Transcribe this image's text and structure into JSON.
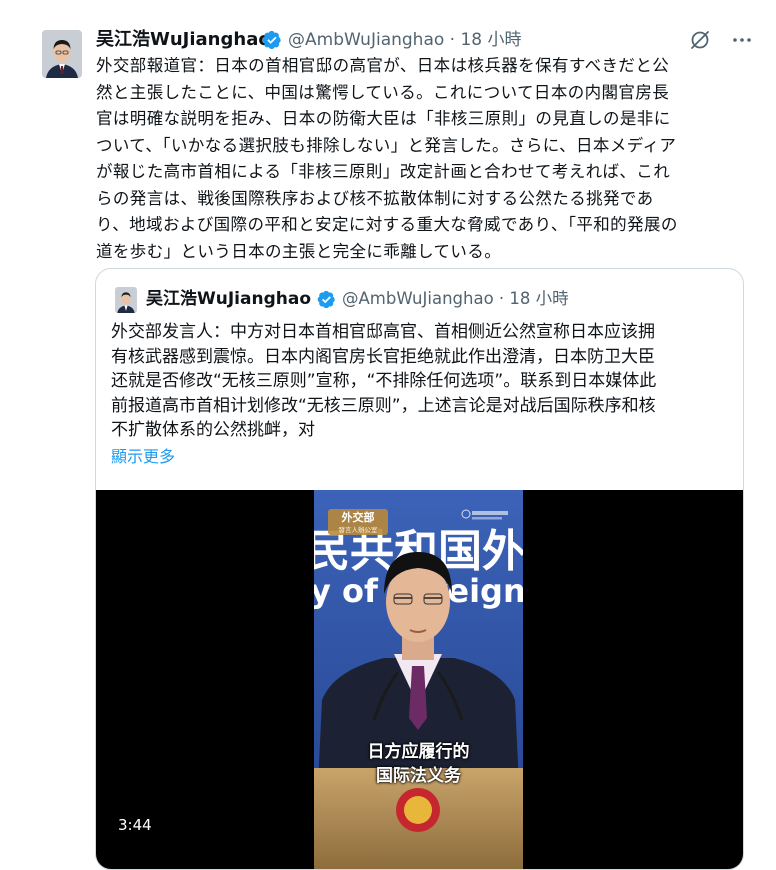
{
  "tweet": {
    "author_name": "吴江浩WuJianghao",
    "handle_time": "@AmbWuJianghao · 18 小時",
    "text_lines": [
      "外交部報道官：日本の首相官邸の高官が、日本は核兵器を保有すべきだと公",
      "然と主張したことに、中国は驚愕している。これについて日本の内閣官房長",
      "官は明確な説明を拒み、日本の防衛大臣は「非核三原則」の見直しの是非に",
      "ついて、「いかなる選択肢も排除しない」と発言した。さらに、日本メディア",
      "が報じた高市首相による「非核三原則」改定計画と合わせて考えれば、これ",
      "らの発言は、戦後国際秩序および核不拡散体制に対する公然たる挑発であ",
      "り、地域および国際の平和と安定に対する重大な脅威であり、「平和的発展の",
      "道を歩む」という日本の主張と完全に乖離している。"
    ]
  },
  "quote": {
    "author_name": "吴江浩WuJianghao",
    "handle_time": "@AmbWuJianghao · 18 小時",
    "text_lines": [
      "外交部发言人：中方对日本首相官邸高官、首相侧近公然宣称日本应该拥",
      "有核武器感到震惊。日本内阁官房长官拒绝就此作出澄清，日本防卫大臣",
      "还就是否修改“无核三原则”宣称，“不排除任何选项”。联系到日本媒体此",
      "前报道高市首相计划修改“无核三原则”，上述言论是对战后国际秩序和核",
      "不扩散体系的公然挑衅，对"
    ],
    "show_more": "顯示更多"
  },
  "video": {
    "duration": "3:44",
    "badge_top": "外交部",
    "badge_bottom": "發言人辦公室",
    "backdrop_text": "民共和国外",
    "backdrop_text2": "y of Foreign",
    "subtitle_line1": "日方应履行的",
    "subtitle_line2": "国际法义务"
  },
  "colors": {
    "accent": "#1d9bf0",
    "text": "#0f1419",
    "secondary": "#536471",
    "border": "#cfd9de"
  }
}
